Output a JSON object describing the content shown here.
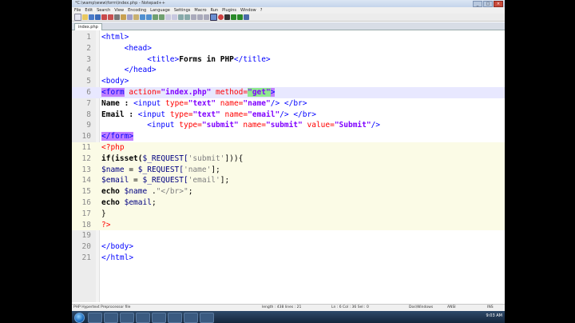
{
  "window": {
    "title": "*C:\\wamp\\www\\form\\index.php - Notepad++",
    "buttons": [
      "_",
      "□",
      "×"
    ]
  },
  "menu": [
    "File",
    "Edit",
    "Search",
    "View",
    "Encoding",
    "Language",
    "Settings",
    "Macro",
    "Run",
    "Plugins",
    "Window",
    "?"
  ],
  "tab": {
    "label": "index.php"
  },
  "code_lines": [
    {
      "n": "1"
    },
    {
      "n": "2"
    },
    {
      "n": "3"
    },
    {
      "n": "4"
    },
    {
      "n": "5"
    },
    {
      "n": "6"
    },
    {
      "n": "7"
    },
    {
      "n": "8"
    },
    {
      "n": "9"
    },
    {
      "n": "10"
    },
    {
      "n": "11"
    },
    {
      "n": "12"
    },
    {
      "n": "13"
    },
    {
      "n": "14"
    },
    {
      "n": "15"
    },
    {
      "n": "16"
    },
    {
      "n": "17"
    },
    {
      "n": "18"
    },
    {
      "n": "19"
    },
    {
      "n": "20"
    },
    {
      "n": "21"
    }
  ],
  "code": {
    "l1_open": "<html>",
    "l2_open": "<head>",
    "l3_open": "<title>",
    "l3_text": "Forms in PHP",
    "l3_close": "</title>",
    "l4_close": "</head>",
    "l5_open": "<body>",
    "l6_tag": "<form",
    "l6_attr1": "action=",
    "l6_val1": "\"index.php\"",
    "l6_attr2": "method=",
    "l6_val2": "\"get\"",
    "l6_end": ">",
    "l7_label": "Name :",
    "l7_tag": "<input",
    "l7_attr1": "type=",
    "l7_val1": "\"text\"",
    "l7_attr2": "name=",
    "l7_val2": "\"name\"",
    "l7_close": "/> </br>",
    "l8_label": "Email :",
    "l8_tag": "<input",
    "l8_attr1": "type=",
    "l8_val1": "\"text\"",
    "l8_attr2": "name=",
    "l8_val2": "\"email\"",
    "l8_close": "/> </br>",
    "l9_tag": "<input",
    "l9_attr1": "type=",
    "l9_val1": "\"submit\"",
    "l9_attr2": "name=",
    "l9_val2": "\"submit\"",
    "l9_attr3": "value=",
    "l9_val3": "\"Submit\"",
    "l9_close": "/>",
    "l10_close": "</form>",
    "l11_php": "<?php",
    "l12_kw": "if(isset(",
    "l12_var": "$_REQUEST[",
    "l12_str": "'submit'",
    "l12_end": "])){",
    "l13_var": "$name",
    "l13_eq": " = ",
    "l13_req": "$_REQUEST[",
    "l13_str": "'name'",
    "l13_end": "];",
    "l14_var": "$email",
    "l14_eq": " = ",
    "l14_req": "$_REQUEST[",
    "l14_str": "'email'",
    "l14_end": "];",
    "l15_kw": "echo",
    "l15_var": " $name ",
    "l15_dot": ".",
    "l15_str": "\"</br>\"",
    "l15_end": ";",
    "l16_kw": "echo",
    "l16_var": " $email",
    "l16_end": ";",
    "l17_text": "}",
    "l18_php": "?>",
    "l20_close": "</body>",
    "l21_close": "</html>"
  },
  "status": {
    "lang": "PHP Hypertext Preprocessor file",
    "length": "length : 438   lines : 21",
    "pos": "Ln : 6   Col : 36   Sel : 0",
    "eol": "Dos\\Windows",
    "enc": "ANSI",
    "mode": "INS"
  },
  "tray": {
    "time": "9:03 AM"
  }
}
